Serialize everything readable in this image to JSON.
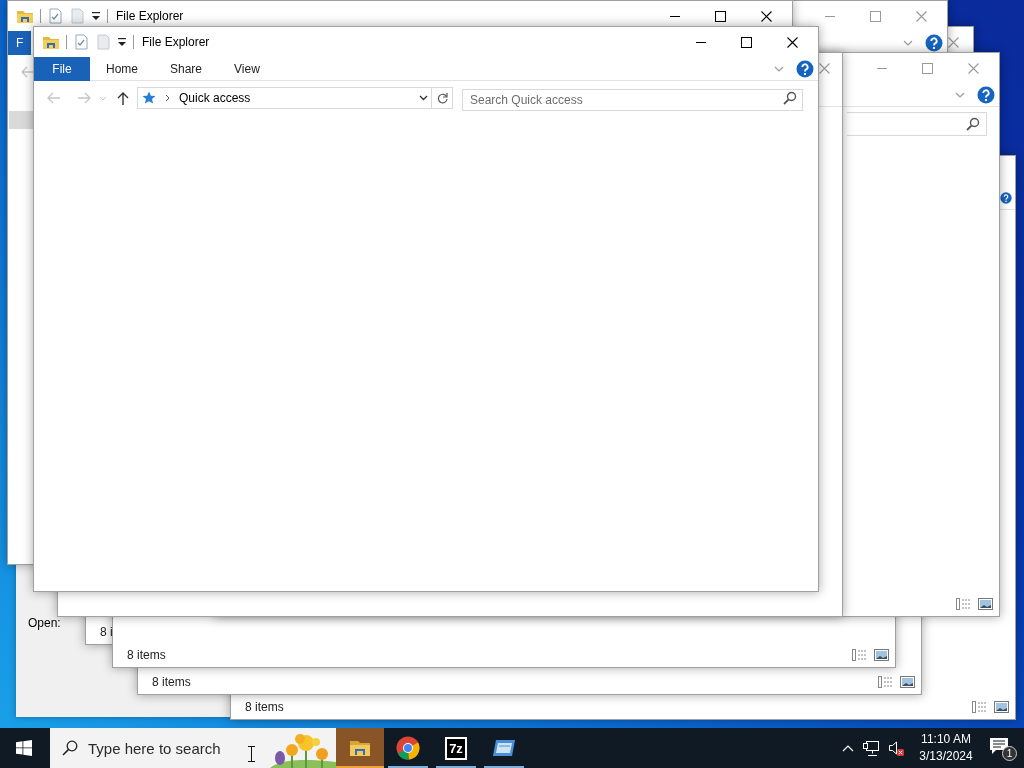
{
  "desktop": {
    "windows": [
      {
        "active": true,
        "title": "File Explorer",
        "tabs": [
          {
            "label": "F",
            "selected": true
          }
        ]
      },
      {
        "active": false
      },
      {
        "active": true,
        "title": "File Explorer",
        "tabs": [
          {
            "label": "File",
            "selected": true
          },
          {
            "label": "Home",
            "selected": false
          },
          {
            "label": "Share",
            "selected": false
          },
          {
            "label": "View",
            "selected": false
          }
        ],
        "address": "Quick access",
        "search": {
          "placeholder": "Search Quick access"
        }
      },
      {
        "active": false
      },
      {
        "active": false
      },
      {
        "active": false
      },
      {
        "status": "8 items"
      },
      {
        "status": "8 i"
      },
      {
        "status": "8 items"
      },
      {
        "status": "8 items"
      }
    ],
    "run_dialog": {
      "label": "Open:"
    }
  },
  "taskbar": {
    "search": {
      "placeholder": "Type here to search"
    },
    "apps": [
      {
        "kind": "folder",
        "selected": true,
        "running": true
      },
      {
        "kind": "browser",
        "selected": false,
        "running": true
      },
      {
        "kind": "archiver",
        "label": "7z",
        "selected": false,
        "running": true
      },
      {
        "kind": "window",
        "selected": false,
        "running": true
      }
    ],
    "clock": {
      "time": "11:10 AM",
      "date": "3/13/2024"
    },
    "notifications": {
      "count": "1"
    }
  }
}
